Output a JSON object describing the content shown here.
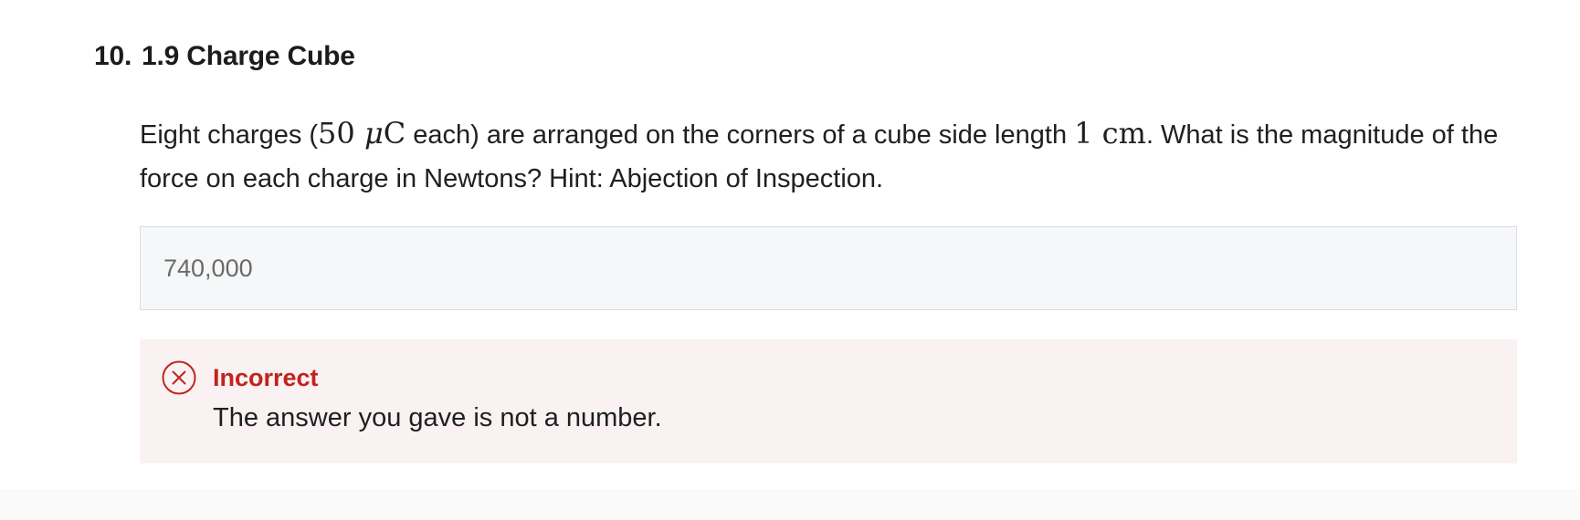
{
  "question": {
    "number": "10.",
    "title": "1.9 Charge Cube",
    "prompt": {
      "part1": "Eight charges (",
      "charge_value": "50",
      "charge_unit_prefix": "μ",
      "charge_unit": "C",
      "part2": " each) are arranged on the corners of a cube side length ",
      "length_value": "1",
      "length_unit": "cm",
      "part3": ". What is the magnitude of the force on each charge in Newtons? Hint: Abjection of Inspection."
    },
    "answer": {
      "value": "740,000"
    },
    "feedback": {
      "status": "Incorrect",
      "message": "The answer you gave is not a number.",
      "icon": "x-circle-icon",
      "color": "#c2231f",
      "background": "#faf2f2"
    }
  }
}
